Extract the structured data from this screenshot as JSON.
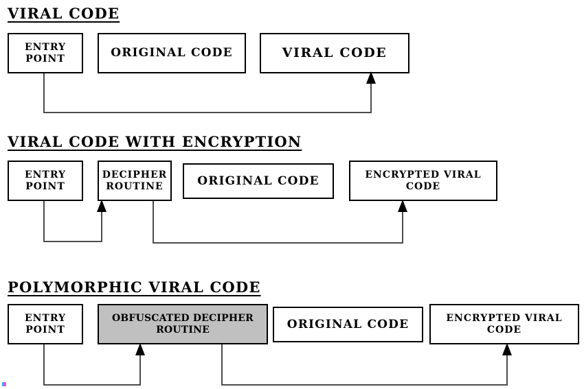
{
  "diagram": {
    "title_note": "Three-stage virus code layout comparison",
    "background_color": "#ffffff",
    "line_color": "#4b4b4b",
    "border_color": "#000000",
    "highlight_fill": "#c0c0c0"
  },
  "sections": [
    {
      "id": "viral-code",
      "heading": "VIRAL CODE",
      "nodes": [
        {
          "id": "entry-point",
          "label": "ENTRY\nPOINT",
          "filled": false
        },
        {
          "id": "original-code",
          "label": "ORIGINAL CODE",
          "filled": false
        },
        {
          "id": "viral-code",
          "label": "VIRAL CODE",
          "filled": false
        }
      ],
      "connections": [
        {
          "from": "entry-point",
          "to": "viral-code"
        }
      ]
    },
    {
      "id": "viral-code-with-encryption",
      "heading": "VIRAL CODE WITH ENCRYPTION",
      "nodes": [
        {
          "id": "entry-point",
          "label": "ENTRY\nPOINT",
          "filled": false
        },
        {
          "id": "decipher-routine",
          "label": "DECIPHER\nROUTINE",
          "filled": false
        },
        {
          "id": "original-code",
          "label": "ORIGINAL CODE",
          "filled": false
        },
        {
          "id": "encrypted-viral-code",
          "label": "ENCRYPTED VIRAL\nCODE",
          "filled": false
        }
      ],
      "connections": [
        {
          "from": "entry-point",
          "to": "decipher-routine"
        },
        {
          "from": "decipher-routine",
          "to": "encrypted-viral-code"
        }
      ]
    },
    {
      "id": "polymorphic-viral-code",
      "heading": "POLYMORPHIC VIRAL CODE",
      "nodes": [
        {
          "id": "entry-point",
          "label": "ENTRY\nPOINT",
          "filled": false
        },
        {
          "id": "obfuscated-decipher-routine",
          "label": "OBFUSCATED DECIPHER\nROUTINE",
          "filled": true
        },
        {
          "id": "original-code",
          "label": "ORIGINAL CODE",
          "filled": false
        },
        {
          "id": "encrypted-viral-code",
          "label": "ENCRYPTED VIRAL\nCODE",
          "filled": false
        }
      ],
      "connections": [
        {
          "from": "entry-point",
          "to": "obfuscated-decipher-routine"
        },
        {
          "from": "obfuscated-decipher-routine",
          "to": "encrypted-viral-code"
        }
      ]
    }
  ]
}
